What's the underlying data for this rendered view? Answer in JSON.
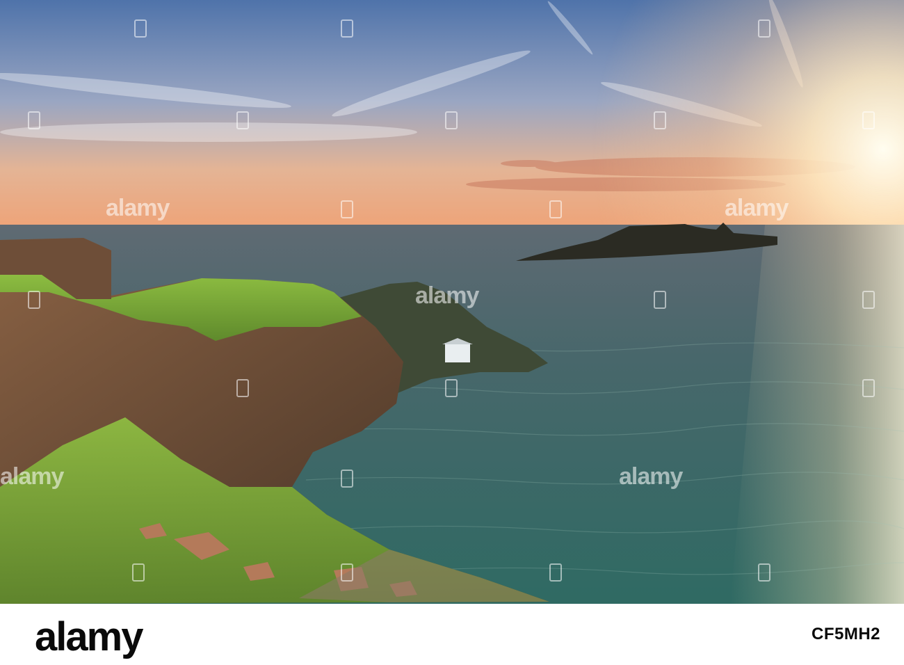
{
  "image": {
    "subject": "",
    "colors": {
      "sky_top": "#5a7fb5",
      "sky_horizon": "#e9a67a",
      "sun": "#fff6d8",
      "sea_near": "#2f6a66",
      "sea_far": "#5d6f78",
      "grass": "#7fae3a",
      "cliff": "#6b4a35",
      "island": "#2a2a22"
    }
  },
  "watermark": {
    "text": "alamy"
  },
  "footer": {
    "logo": "alamy",
    "stock_id": "CF5MH2"
  }
}
